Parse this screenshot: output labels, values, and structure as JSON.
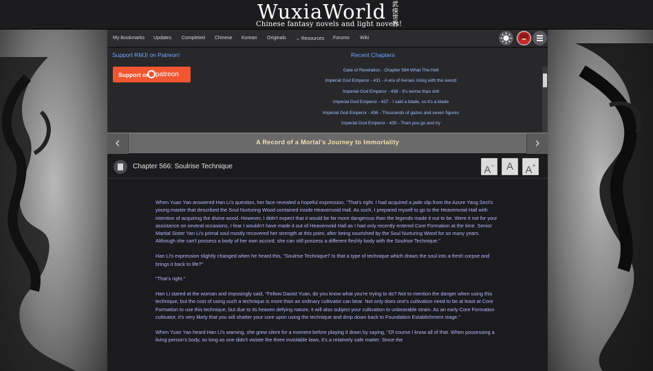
{
  "header": {
    "logo_main": "WuxiaWorld",
    "logo_sub": "Chinese fantasy novels and light novels!",
    "logo_cn": "武侠世界"
  },
  "nav": {
    "items": [
      "My Bookmarks",
      "Updates",
      "Completed",
      "Chinese",
      "Korean",
      "Originals",
      "Resources",
      "Forums",
      "Wiki"
    ],
    "theme_icon": "sun-icon",
    "menu_icon": "hamburger-icon"
  },
  "promo": {
    "title": "Support RMJI on Patreon!",
    "button_text": "Support on",
    "button_brand": "patreon"
  },
  "recent": {
    "title": "Recent Chapters",
    "items": [
      "Gate of Revelation - Chapter 584 What The Hell",
      "Imperial God Emperor - 431 - A era of heroes rising with the sword",
      "Imperial God Emperor - 438 - It's worse than shit",
      "Imperial God Emperor - 437 - I said a blade, so it's a blade",
      "Imperial God Emperor - 436 - Thousands of gazes and seven figures",
      "Imperial God Emperor - 435 - Then you go and try"
    ]
  },
  "chapter": {
    "book_title": "A Record of a Mortal's Journey to Immortality",
    "title": "Chapter 566: Soulrise Technique",
    "font_decrease": "A",
    "font_reset": "A",
    "font_increase": "A",
    "paragraphs": [
      "When Yuan Yao answered Han Li's question, her face revealed a hopeful expression, \"That's right. I had acquired a jade slip from the Azure Yang Sect's young master that described the Soul Nurturing Wood contained inside Heavenvoid Hall. As such, I prepared myself to go to the Heavenvoid Hall with intention of acquiring the divine wood. However, I didn't expect that it would be far more dangerous than the legends made it out to be. Were it not for your assistance on several occasions, I fear I wouldn't have made it out of Heavenvoid Hall as I had only recently entered Core Formation at the time. Senior Martial Sister Yan Li's primal soul mostly recovered her strength at this point, after being nourished by the Soul Nurturing Wood for so many years. Although she can't possess a body of her own accord, she can still possess a different fleshly body with the Soulrise Technique.\"",
      "Han Li's expression slightly changed when he heard this, \"Soulrise Technique? Is that a type of technique which draws the soul into a fresh corpse and brings it back to life?\"",
      "\"That's right.\"",
      "Han Li stared at the woman and imposingly said, \"Fellow Daoist Yuan, do you know what you're trying to do? Not to mention the danger when using this technique, but the cost of using such a technique is more than an ordinary cultivator can bear. Not only does one's cultivation need to be at least at Core Formation to use this technique, but due to its heaven defying nature, it will also subject your cultivation to unbearable strain. As an early Core Formation cultivator, it's very likely that you will shatter your core upon using the technique and drop down back to Foundation Establishment stage.\"",
      "When Yuan Yao heard Han Li's warning, she grew silent for a moment before playing it down by saying, \"Of course I know all of that. When possessing a living person's body, so long as one didn't violate the three inviolable laws, it's a relatively safe matter. Since the"
    ]
  }
}
